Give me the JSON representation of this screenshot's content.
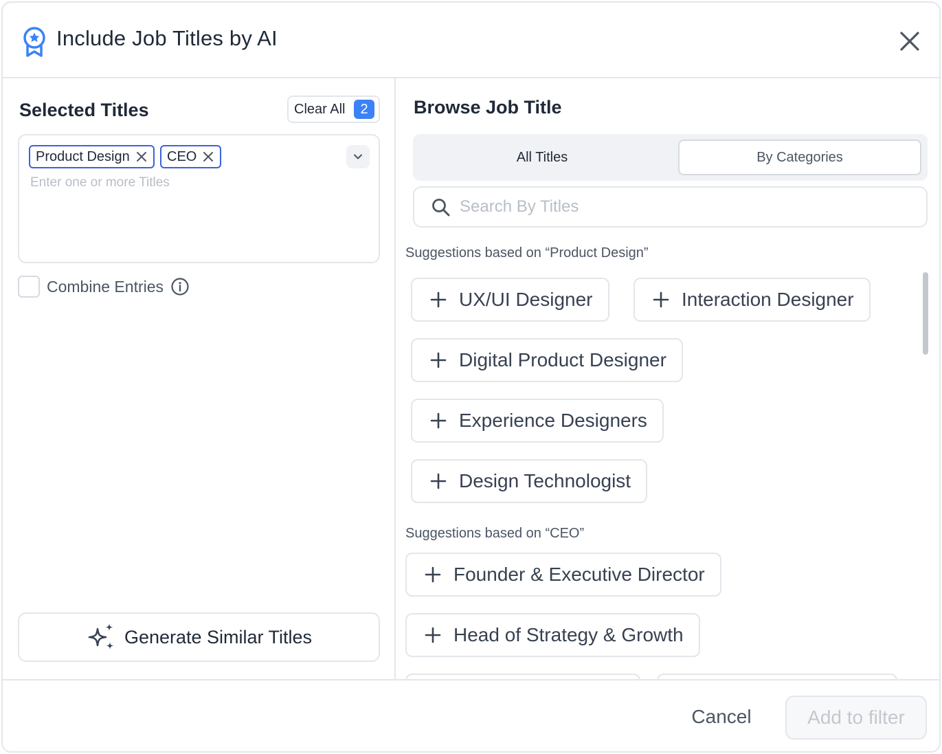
{
  "header": {
    "title": "Include Job Titles by AI",
    "icon": "award-badge-icon",
    "accent": "#3b82f6"
  },
  "left": {
    "section_title": "Selected Titles",
    "clear_all_label": "Clear All",
    "selected_count": "2",
    "chips": [
      {
        "label": "Product Design"
      },
      {
        "label": "CEO"
      }
    ],
    "input_placeholder": "Enter one or more Titles",
    "combine_label": "Combine Entries",
    "generate_label": "Generate Similar Titles"
  },
  "right": {
    "section_title": "Browse Job Title",
    "tabs": [
      {
        "label": "All Titles"
      },
      {
        "label": "By Categories"
      }
    ],
    "search_placeholder": "Search By Titles",
    "groups": [
      {
        "label": "Suggestions based on “Product Design”",
        "items": [
          "UX/UI Designer",
          "Interaction Designer",
          "Digital Product Designer",
          "Experience Designers",
          "Design Technologist"
        ]
      },
      {
        "label": "Suggestions based on “CEO”",
        "items": [
          "Founder & Executive Director",
          "Head of Strategy & Growth"
        ]
      }
    ]
  },
  "footer": {
    "cancel_label": "Cancel",
    "add_label": "Add to filter"
  }
}
